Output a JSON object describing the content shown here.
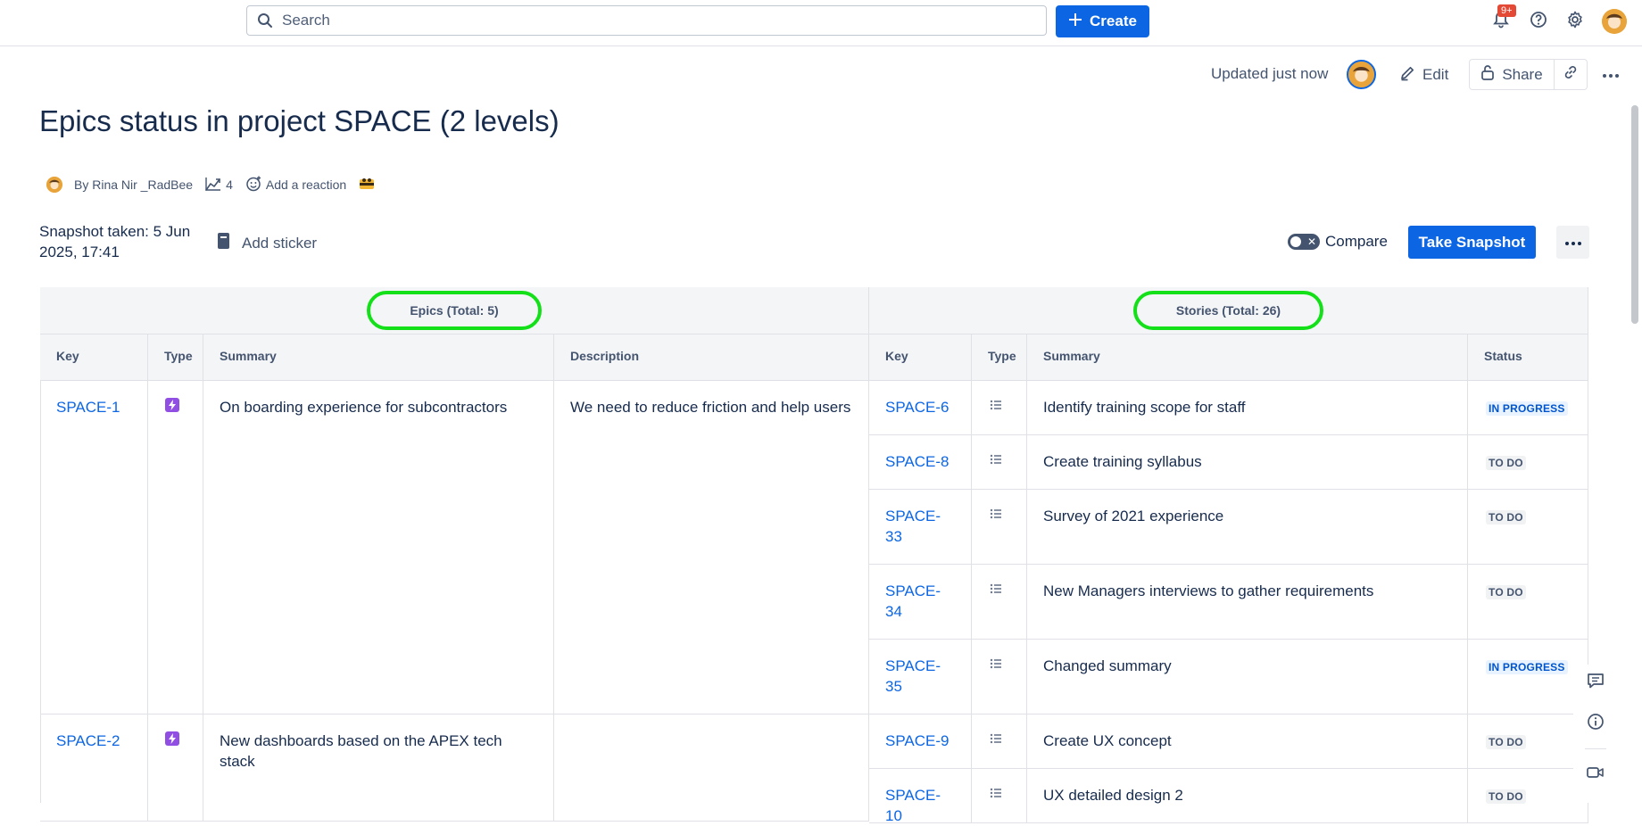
{
  "topbar": {
    "search_placeholder": "Search",
    "create_label": "Create",
    "notification_badge": "9+"
  },
  "page_header": {
    "updated_text": "Updated just now",
    "edit_label": "Edit",
    "share_label": "Share"
  },
  "page": {
    "title": "Epics status in project SPACE (2 levels)",
    "author": "By Rina Nir _RadBee",
    "views_count": "4",
    "reaction_label": "Add a reaction"
  },
  "snapshot": {
    "taken_text": "Snapshot taken: 5 Jun 2025, 17:41",
    "add_sticker_label": "Add sticker",
    "compare_label": "Compare",
    "take_snapshot_label": "Take Snapshot"
  },
  "table": {
    "epics_group_label": "Epics (Total: 5)",
    "stories_group_label": "Stories (Total: 26)",
    "epic_headers": [
      "Key",
      "Type",
      "Summary",
      "Description"
    ],
    "story_headers": [
      "Key",
      "Type",
      "Summary",
      "Status"
    ],
    "epics": [
      {
        "key": "SPACE-1",
        "type": "epic",
        "summary": "On boarding experience for subcontractors",
        "description": "We need to reduce friction and help users"
      },
      {
        "key": "SPACE-2",
        "type": "epic",
        "summary": "New dashboards based on the APEX tech stack",
        "description": ""
      }
    ],
    "stories": [
      {
        "key": "SPACE-6",
        "summary": "Identify training scope for staff",
        "status": "IN PROGRESS"
      },
      {
        "key": "SPACE-8",
        "summary": "Create training syllabus",
        "status": "TO DO"
      },
      {
        "key": "SPACE-33",
        "summary": "Survey of 2021 experience",
        "status": "TO DO"
      },
      {
        "key": "SPACE-34",
        "summary": "New Managers interviews to gather requirements",
        "status": "TO DO"
      },
      {
        "key": "SPACE-35",
        "summary": "Changed summary",
        "status": "IN PROGRESS"
      },
      {
        "key": "SPACE-9",
        "summary": "Create UX concept",
        "status": "TO DO"
      },
      {
        "key": "SPACE-10",
        "summary": "UX detailed design 2",
        "status": "TO DO"
      }
    ]
  },
  "colors": {
    "primary": "#0c66e4",
    "highlight_ring": "#14e01a",
    "epic_icon": "#904ee2",
    "in_progress_bg": "#e9f2ff",
    "in_progress_text": "#0055cc",
    "todo_bg": "#f1f2f4"
  },
  "icons": {
    "search": "search-icon",
    "create": "plus-icon",
    "notifications": "bell-icon",
    "help": "help-icon",
    "settings": "gear-icon",
    "edit": "pencil-icon",
    "share": "lock-icon",
    "link": "link-icon",
    "more": "ellipsis-icon",
    "views": "analytics-icon",
    "reaction": "emoji-add-icon",
    "sticker": "sticker-icon",
    "epic": "lightning-icon",
    "story": "subtask-list-icon",
    "comments": "comment-icon",
    "info": "info-icon",
    "video": "video-icon"
  }
}
